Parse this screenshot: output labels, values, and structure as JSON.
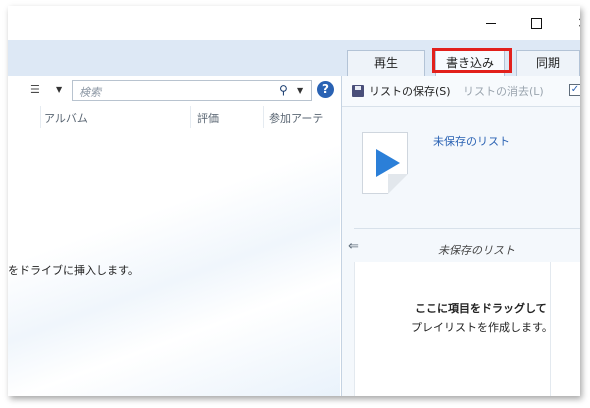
{
  "window": {
    "minimize_label": "",
    "maximize_label": "",
    "close_label": "×"
  },
  "tabs": [
    {
      "label": "再生"
    },
    {
      "label": "書き込み"
    },
    {
      "label": "同期"
    }
  ],
  "toolbar": {
    "view_options_icon": "list-view-icon",
    "search_placeholder": "検索",
    "search_icon": "⚲",
    "help_label": "?"
  },
  "columns": [
    "アルバム",
    "評価",
    "参加アーテ"
  ],
  "library": {
    "message": "をドライブに挿入します。"
  },
  "burn_pane": {
    "save_list": "リストの保存(S)",
    "clear_list": "リストの消去(L)",
    "unsaved_title": "未保存のリスト",
    "unsaved_label": "未保存のリスト",
    "drop_message_1": "ここに項目をドラッグして",
    "drop_message_2": "プレイリストを作成します。"
  },
  "colors": {
    "accent": "#2a62b3",
    "highlight": "#e2201c",
    "play_icon": "#2b7fd8"
  }
}
